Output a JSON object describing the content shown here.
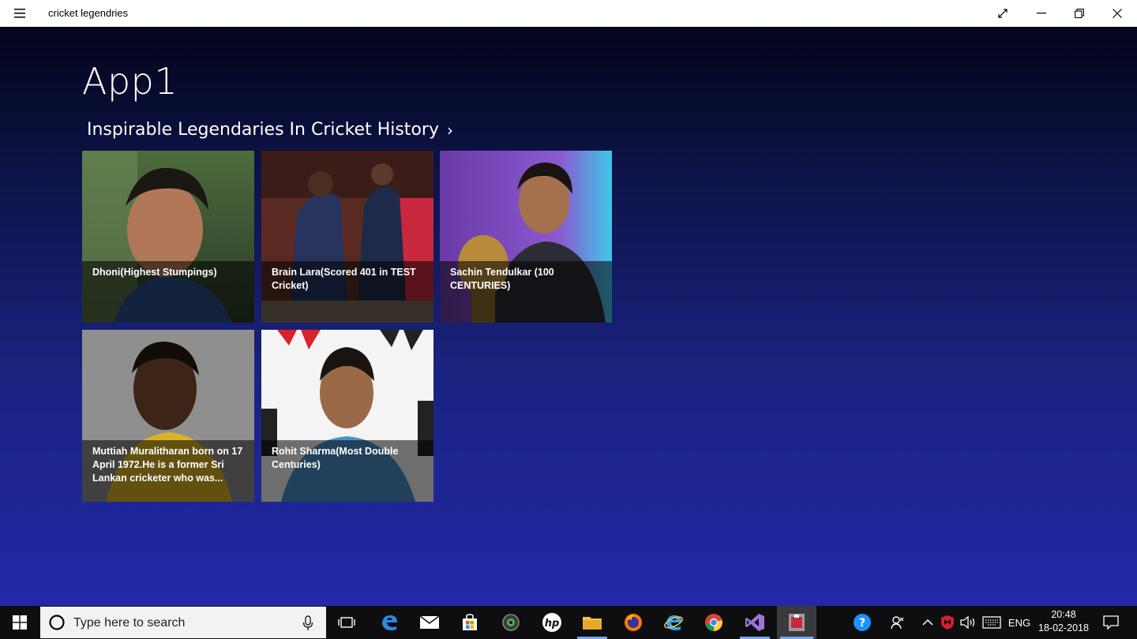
{
  "window": {
    "title": "cricket legendries"
  },
  "app": {
    "title": "App1",
    "section_header": "Inspirable Legendaries In Cricket History",
    "section_chevron": "›",
    "tiles": [
      {
        "caption": "Dhoni(Highest Stumpings)"
      },
      {
        "caption": "Brain Lara(Scored 401 in TEST Cricket)"
      },
      {
        "caption": "Sachin Tendulkar (100 CENTURIES)"
      },
      {
        "caption": "Muttiah Muralitharan born on 17 April 1972.He is a former Sri Lankan cricketer who was..."
      },
      {
        "caption": "Rohit Sharma(Most Double Centuries)"
      }
    ]
  },
  "taskbar": {
    "search_placeholder": "Type here to search",
    "language": "ENG",
    "time": "20:48",
    "date": "18-02-2018",
    "apps": [
      "task-view",
      "edge",
      "mail",
      "store",
      "media-player",
      "hp",
      "file-explorer",
      "firefox",
      "internet-explorer",
      "chrome",
      "visual-studio",
      "cricket-app"
    ]
  },
  "colors": {
    "background_top": "#03051a",
    "background_bottom": "#2228a8",
    "titlebar": "#ffffff",
    "taskbar": "#0e0e10"
  }
}
